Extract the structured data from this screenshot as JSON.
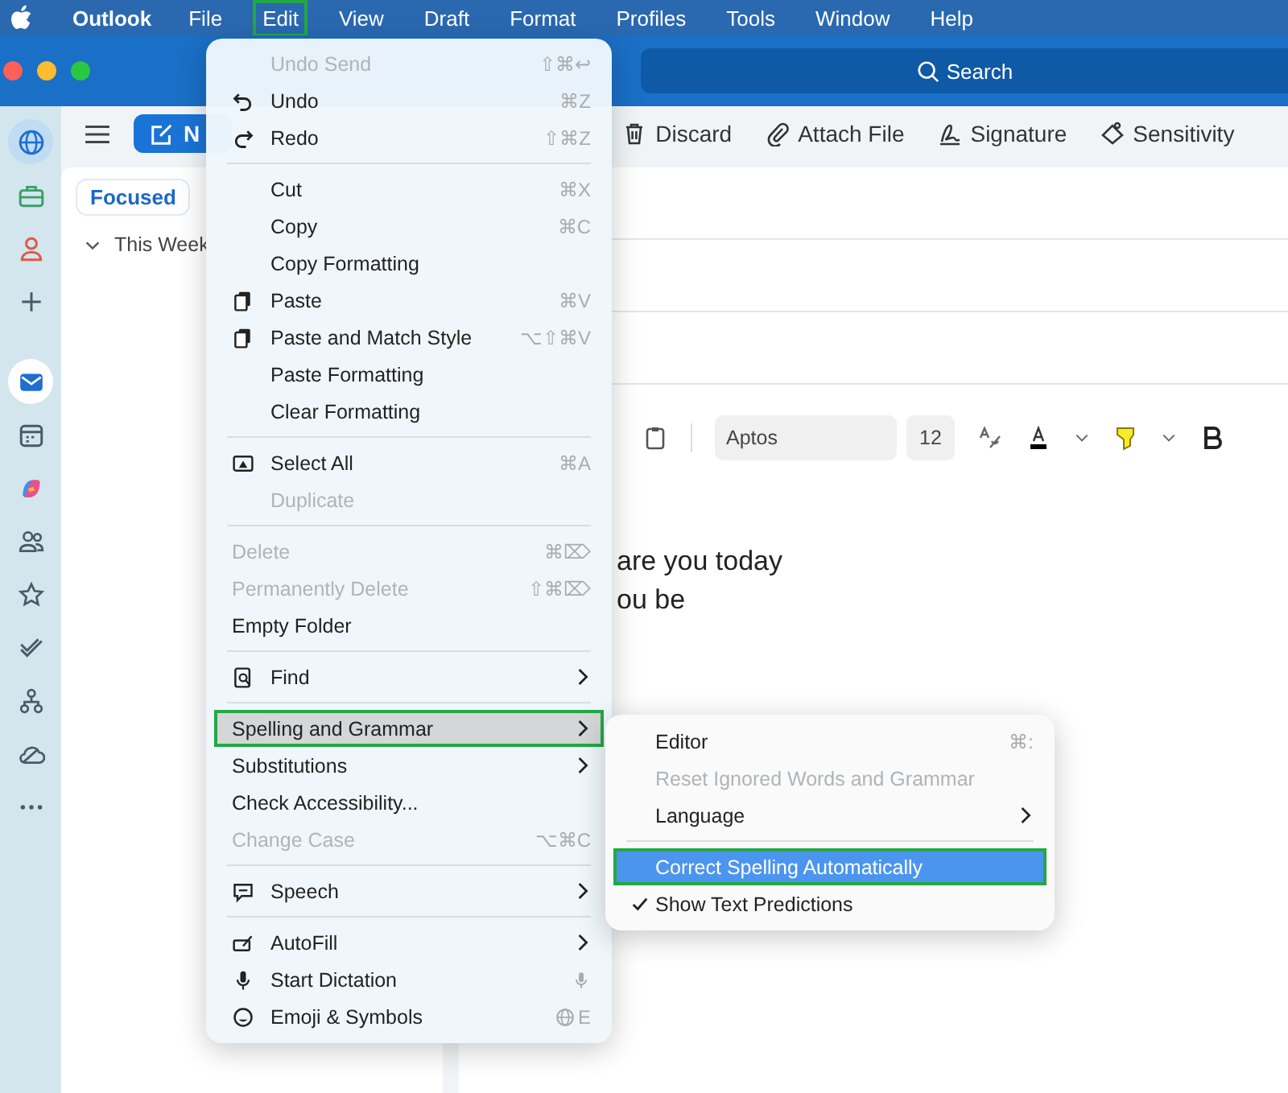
{
  "menubar": {
    "app": "Outlook",
    "items": [
      {
        "label": "File",
        "selected": false
      },
      {
        "label": "Edit",
        "selected": true
      },
      {
        "label": "View",
        "selected": false
      },
      {
        "label": "Draft",
        "selected": false
      },
      {
        "label": "Format",
        "selected": false
      },
      {
        "label": "Profiles",
        "selected": false
      },
      {
        "label": "Tools",
        "selected": false
      },
      {
        "label": "Window",
        "selected": false
      },
      {
        "label": "Help",
        "selected": false
      }
    ]
  },
  "search": {
    "placeholder": "Search"
  },
  "rail_items": [
    {
      "selected": true
    },
    {
      "selected": false
    },
    {
      "selected": false
    },
    {
      "selected": false
    },
    {
      "selected": true
    },
    {
      "selected": false
    },
    {
      "selected": false
    },
    {
      "selected": false
    },
    {
      "selected": false
    },
    {
      "selected": false
    },
    {
      "selected": false
    },
    {
      "selected": false
    },
    {
      "selected": false
    }
  ],
  "new_button": {
    "label": "N"
  },
  "toolbar": [
    {
      "label": "Discard"
    },
    {
      "label": "Attach File"
    },
    {
      "label": "Signature"
    },
    {
      "label": "Sensitivity"
    }
  ],
  "folder_pane": {
    "tabs": [
      {
        "label": "Focused",
        "selected": true
      }
    ],
    "group": "This Week"
  },
  "format_bar": {
    "font": "Aptos",
    "size": "12"
  },
  "body_lines": [
    "are you today",
    "ou be"
  ],
  "edit_menu": {
    "groups": [
      [
        {
          "label": "Undo Send",
          "shortcut": "⇧⌘↩",
          "disabled": true,
          "submenu": false,
          "selected": false
        },
        {
          "label": "Undo",
          "shortcut": "⌘Z",
          "disabled": false,
          "submenu": false,
          "selected": false
        },
        {
          "label": "Redo",
          "shortcut": "⇧⌘Z",
          "disabled": false,
          "submenu": false,
          "selected": false
        }
      ],
      [
        {
          "label": "Cut",
          "shortcut": "⌘X",
          "disabled": false,
          "submenu": false,
          "selected": false
        },
        {
          "label": "Copy",
          "shortcut": "⌘C",
          "disabled": false,
          "submenu": false,
          "selected": false
        },
        {
          "label": "Copy Formatting",
          "disabled": false,
          "submenu": false,
          "selected": false
        },
        {
          "label": "Paste",
          "shortcut": "⌘V",
          "disabled": false,
          "submenu": false,
          "selected": false
        },
        {
          "label": "Paste and Match Style",
          "shortcut": "⌥⇧⌘V",
          "disabled": false,
          "submenu": false,
          "selected": false
        },
        {
          "label": "Paste Formatting",
          "disabled": false,
          "submenu": false,
          "selected": false
        },
        {
          "label": "Clear Formatting",
          "disabled": false,
          "submenu": false,
          "selected": false
        }
      ],
      [
        {
          "label": "Select All",
          "shortcut": "⌘A",
          "disabled": false,
          "submenu": false,
          "selected": false
        },
        {
          "label": "Duplicate",
          "disabled": true,
          "submenu": false,
          "selected": false
        }
      ],
      [
        {
          "label": "Delete",
          "shortcut": "⌘⌦",
          "disabled": true,
          "submenu": false,
          "selected": false
        },
        {
          "label": "Permanently Delete",
          "shortcut": "⇧⌘⌦",
          "disabled": true,
          "submenu": false,
          "selected": false
        },
        {
          "label": "Empty Folder",
          "disabled": false,
          "submenu": false,
          "selected": false
        }
      ],
      [
        {
          "label": "Find",
          "disabled": false,
          "submenu": true,
          "selected": false
        }
      ],
      [
        {
          "label": "Spelling and Grammar",
          "disabled": false,
          "submenu": true,
          "selected": true
        },
        {
          "label": "Substitutions",
          "disabled": false,
          "submenu": true,
          "selected": false
        },
        {
          "label": "Check Accessibility...",
          "disabled": false,
          "submenu": false,
          "selected": false
        },
        {
          "label": "Change Case",
          "shortcut": "⌥⌘C",
          "disabled": true,
          "submenu": false,
          "selected": false
        }
      ],
      [
        {
          "label": "Speech",
          "disabled": false,
          "submenu": true,
          "selected": false
        }
      ],
      [
        {
          "label": "AutoFill",
          "disabled": false,
          "submenu": true,
          "selected": false
        },
        {
          "label": "Start Dictation",
          "disabled": false,
          "submenu": false,
          "selected": false
        },
        {
          "label": "Emoji & Symbols",
          "shortcut": "E",
          "disabled": false,
          "submenu": false,
          "selected": false
        }
      ]
    ]
  },
  "spelling_submenu": {
    "groups": [
      [
        {
          "label": "Editor",
          "shortcut": "⌘:",
          "disabled": false,
          "submenu": false,
          "selected": false,
          "checked": false
        },
        {
          "label": "Reset Ignored Words and Grammar",
          "disabled": true,
          "submenu": false,
          "selected": false,
          "checked": false
        },
        {
          "label": "Language",
          "disabled": false,
          "submenu": true,
          "selected": false,
          "checked": false
        }
      ],
      [
        {
          "label": "Correct Spelling Automatically",
          "disabled": false,
          "submenu": false,
          "selected": true,
          "checked": false
        },
        {
          "label": "Show Text Predictions",
          "disabled": false,
          "submenu": false,
          "selected": false,
          "checked": true
        }
      ]
    ]
  }
}
